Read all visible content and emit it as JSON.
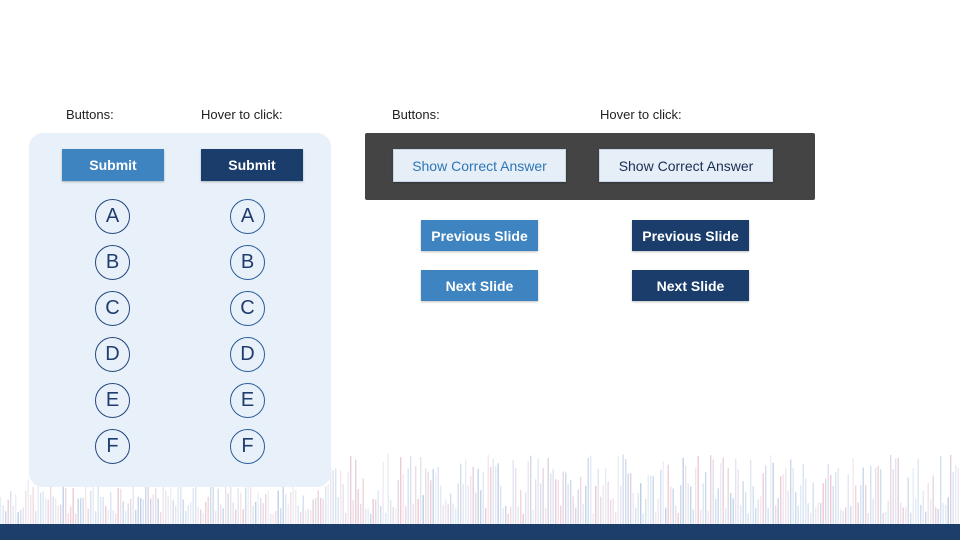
{
  "left_section": {
    "label_normal": "Buttons:",
    "label_hover": "Hover to click:",
    "submit_label": "Submit",
    "options": [
      "A",
      "B",
      "C",
      "D",
      "E",
      "F"
    ]
  },
  "right_section": {
    "label_normal": "Buttons:",
    "label_hover": "Hover to click:",
    "show_correct_answer": "Show Correct Answer",
    "previous_slide": "Previous Slide",
    "next_slide": "Next Slide"
  },
  "colors": {
    "button_normal": "#3e84c0",
    "button_hover": "#1a3d6b",
    "panel_light": "#e8f0f9",
    "panel_dark": "#444444",
    "bottom_bar": "#1d3d6b"
  }
}
